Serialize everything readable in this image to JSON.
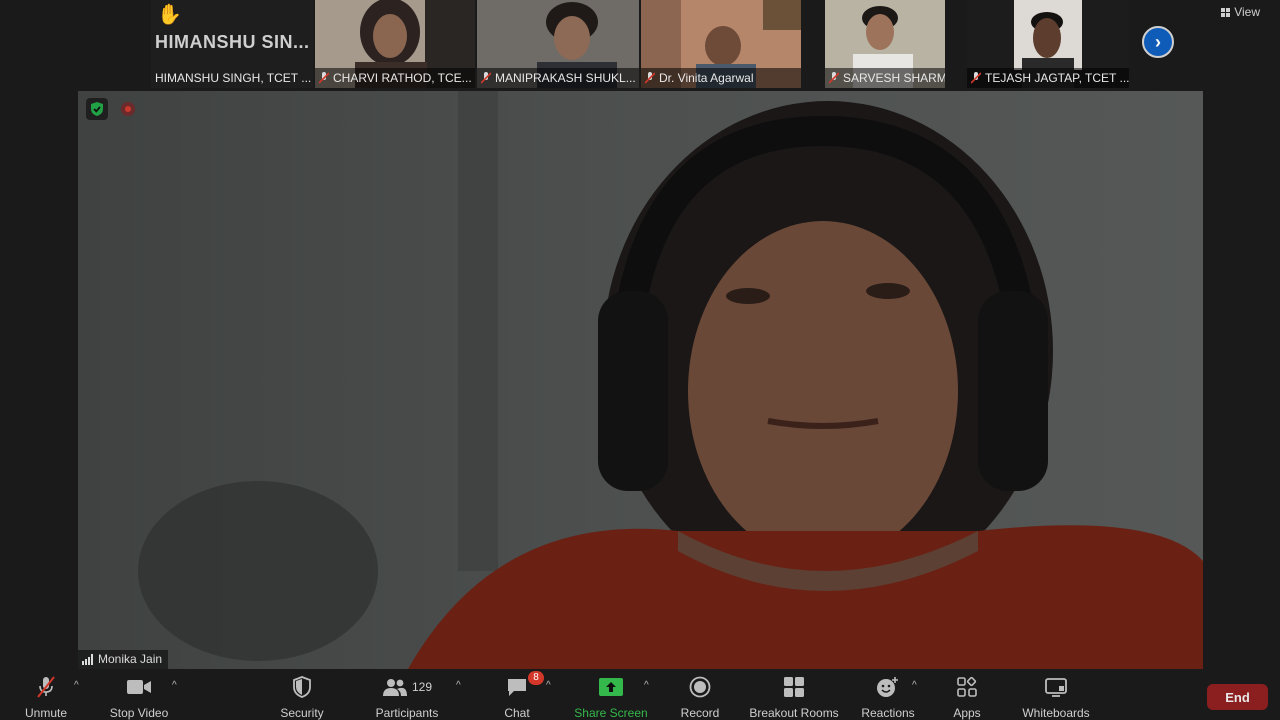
{
  "strip": {
    "view_label": "View",
    "participants": [
      {
        "name": "HIMANSHU SINGH, TCET ...",
        "display_initial": "HIMANSHU  SIN...",
        "has_video": false,
        "raised_hand": true,
        "muted": false
      },
      {
        "name": "CHARVI RATHOD, TCE...",
        "has_video": true,
        "muted": true
      },
      {
        "name": "MANIPRAKASH SHUKL...",
        "has_video": true,
        "muted": true
      },
      {
        "name": "Dr. Vinita Agarwal",
        "has_video": true,
        "muted": true
      },
      {
        "name": "SARVESH SHARMA, TC...",
        "has_video": true,
        "muted": true
      },
      {
        "name": "TEJASH JAGTAP, TCET ...",
        "has_video": true,
        "muted": true
      }
    ],
    "next_icon": "chevron-right-icon"
  },
  "main": {
    "speaker_name": "Monika Jain",
    "security_icon": "shield-check-icon",
    "recording_icon": "record-dot-icon"
  },
  "toolbar": {
    "unmute": "Unmute",
    "stop_video": "Stop Video",
    "security": "Security",
    "participants": "Participants",
    "participants_count": "129",
    "chat": "Chat",
    "chat_badge": "8",
    "share_screen": "Share Screen",
    "record": "Record",
    "breakout_rooms": "Breakout Rooms",
    "reactions": "Reactions",
    "apps": "Apps",
    "whiteboards": "Whiteboards",
    "end": "End"
  },
  "colors": {
    "background": "#1a1a1a",
    "share_green": "#35b84b",
    "end_red": "#8b1e1e",
    "badge_red": "#d2372a",
    "nav_blue": "#0e5bb8"
  }
}
